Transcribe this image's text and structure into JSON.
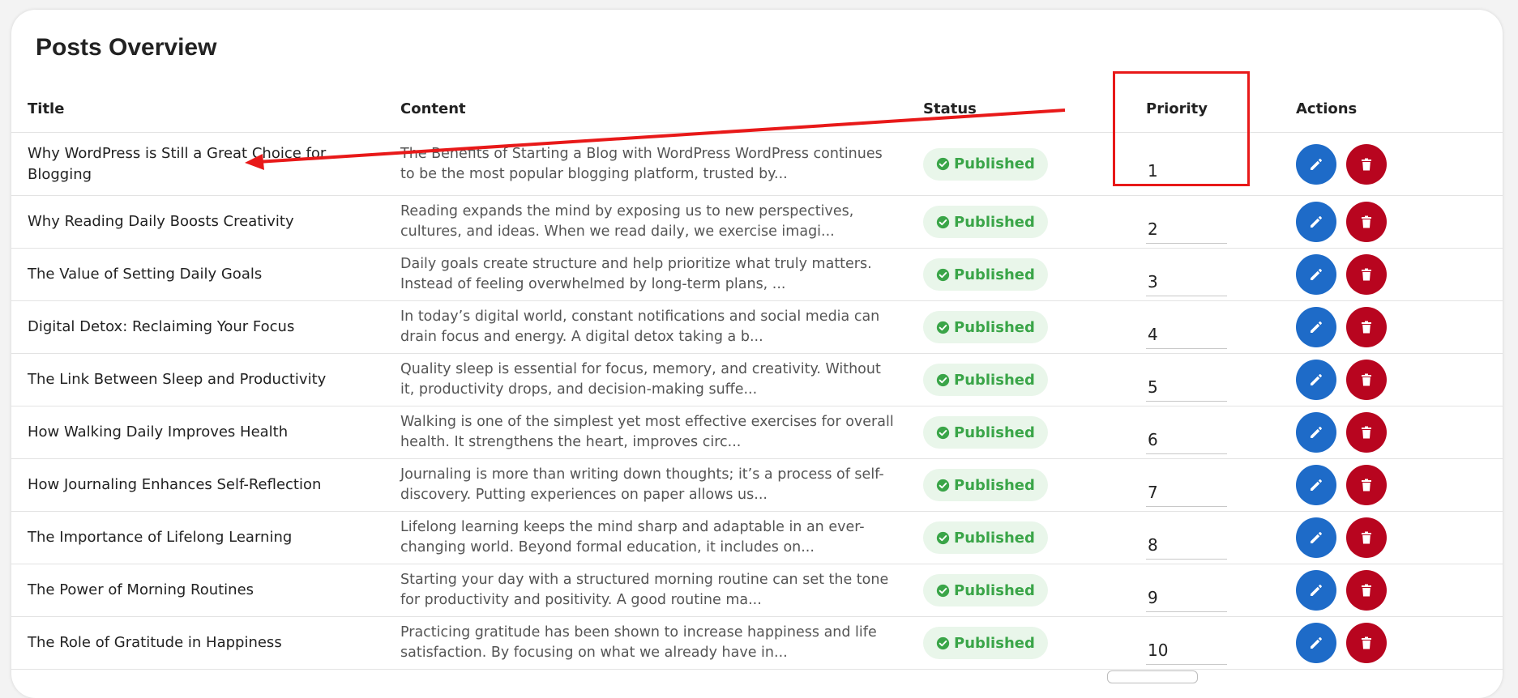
{
  "page_title": "Posts Overview",
  "columns": {
    "title": "Title",
    "content": "Content",
    "status": "Status",
    "priority": "Priority",
    "actions": "Actions"
  },
  "status_color": "#3aa548",
  "edit_button_color": "#1e6bc8",
  "delete_button_color": "#b8051f",
  "annotation_color": "#e81919",
  "rows": [
    {
      "title": "Why WordPress is Still a Great Choice for Blogging",
      "content": "The Benefits of Starting a Blog with WordPress WordPress continues to be the most popular blogging platform, trusted by...",
      "status": "Published",
      "priority": "1"
    },
    {
      "title": "Why Reading Daily Boosts Creativity",
      "content": "Reading expands the mind by exposing us to new perspectives, cultures, and ideas. When we read daily, we exercise imagi...",
      "status": "Published",
      "priority": "2"
    },
    {
      "title": "The Value of Setting Daily Goals",
      "content": "Daily goals create structure and help prioritize what truly matters. Instead of feeling overwhelmed by long-term plans, ...",
      "status": "Published",
      "priority": "3"
    },
    {
      "title": "Digital Detox: Reclaiming Your Focus",
      "content": "In today’s digital world, constant notifications and social media can drain focus and energy. A digital detox taking a b...",
      "status": "Published",
      "priority": "4"
    },
    {
      "title": "The Link Between Sleep and Productivity",
      "content": "Quality sleep is essential for focus, memory, and creativity. Without it, productivity drops, and decision-making suffe...",
      "status": "Published",
      "priority": "5"
    },
    {
      "title": "How Walking Daily Improves Health",
      "content": "Walking is one of the simplest yet most effective exercises for overall health. It strengthens the heart, improves circ...",
      "status": "Published",
      "priority": "6"
    },
    {
      "title": "How Journaling Enhances Self-Reflection",
      "content": "Journaling is more than writing down thoughts; it’s a process of self-discovery. Putting experiences on paper allows us...",
      "status": "Published",
      "priority": "7"
    },
    {
      "title": "The Importance of Lifelong Learning",
      "content": "Lifelong learning keeps the mind sharp and adaptable in an ever-changing world. Beyond formal education, it includes on...",
      "status": "Published",
      "priority": "8"
    },
    {
      "title": "The Power of Morning Routines",
      "content": "Starting your day with a structured morning routine can set the tone for productivity and positivity. A good routine ma...",
      "status": "Published",
      "priority": "9"
    },
    {
      "title": "The Role of Gratitude in Happiness",
      "content": "Practicing gratitude has been shown to increase happiness and life satisfaction. By focusing on what we already have in...",
      "status": "Published",
      "priority": "10"
    }
  ]
}
